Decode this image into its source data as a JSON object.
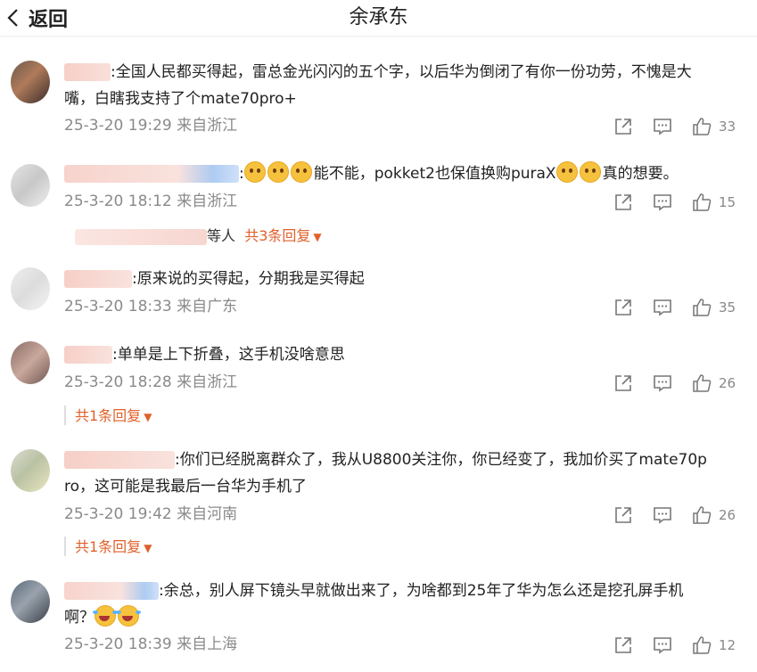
{
  "header": {
    "back_label": "返回",
    "title": "余承东"
  },
  "comments": [
    {
      "text": ":全国人民都买得起，雷总金光闪闪的五个字，以后华为倒闭了有你一份功劳，不愧是大嘴，白瞎我支持了个mate70pro+",
      "meta": "25-3-20 19:29 来自浙江",
      "likes": "33"
    },
    {
      "text_a": ":",
      "text_b": "能不能，pokket2也保值换购puraX",
      "text_c": "真的想要。",
      "meta": "25-3-20 18:12 来自浙江",
      "likes": "15",
      "reply_prefix": "等人",
      "replies": "共3条回复"
    },
    {
      "text": ":原来说的买得起，分期我是买得起",
      "meta": "25-3-20 18:33 来自广东",
      "likes": "35"
    },
    {
      "text": ":单单是上下折叠，这手机没啥意思",
      "meta": "25-3-20 18:28 来自浙江",
      "likes": "26",
      "replies": "共1条回复"
    },
    {
      "text": ":你们已经脱离群众了，我从U8800关注你，你已经变了，我加价买了mate70pro，这可能是我最后一台华为手机了",
      "meta": "25-3-20 19:42 来自河南",
      "likes": "26",
      "replies": "共1条回复"
    },
    {
      "text": ":余总，别人屏下镜头早就做出来了，为啥都到25年了华为怎么还是挖孔屏手机啊？",
      "meta": "25-3-20 18:39 来自上海",
      "likes": "12"
    }
  ],
  "icons": {
    "share": "share-icon",
    "comment": "comment-icon",
    "like": "like-icon"
  }
}
